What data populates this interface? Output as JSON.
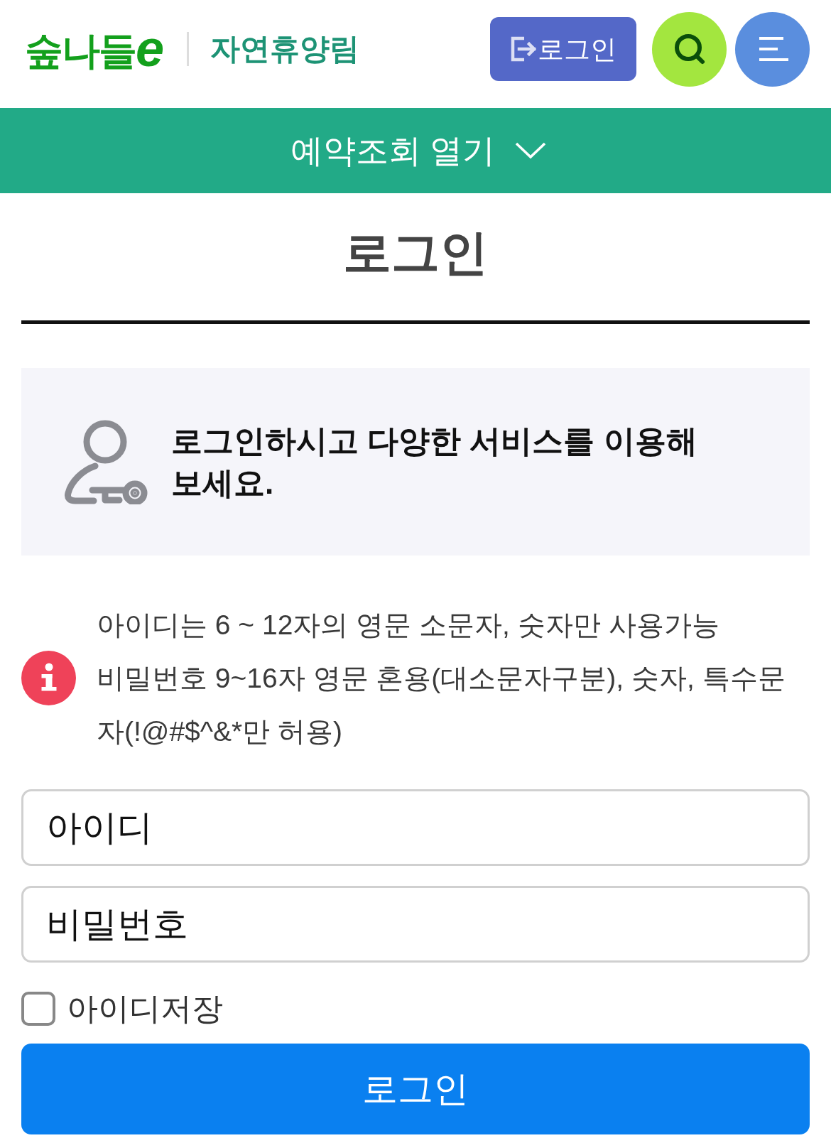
{
  "header": {
    "logo": {
      "letters": "숲나들",
      "suffix": "e"
    },
    "site_name": "자연휴양림",
    "login_button": "로그인"
  },
  "reservation_bar": {
    "label": "예약조회 열기",
    "expanded": false
  },
  "page_title": "로그인",
  "notice": {
    "message": "로그인하시고 다양한 서비스를 이용해 보세요."
  },
  "rules": [
    "아이디는 6 ~ 12자의 영문 소문자, 숫자만 사용가능",
    "비밀번호 9~16자 영문 혼용(대소문자구분), 숫자, 특수문자(!@#$^&*만 허용)"
  ],
  "form": {
    "username_field": {
      "placeholder": "아이디"
    },
    "password_field": {
      "placeholder": "비밀번호"
    },
    "remember_id": {
      "label": "아이디저장",
      "checked": false
    },
    "submit": "로그인"
  }
}
